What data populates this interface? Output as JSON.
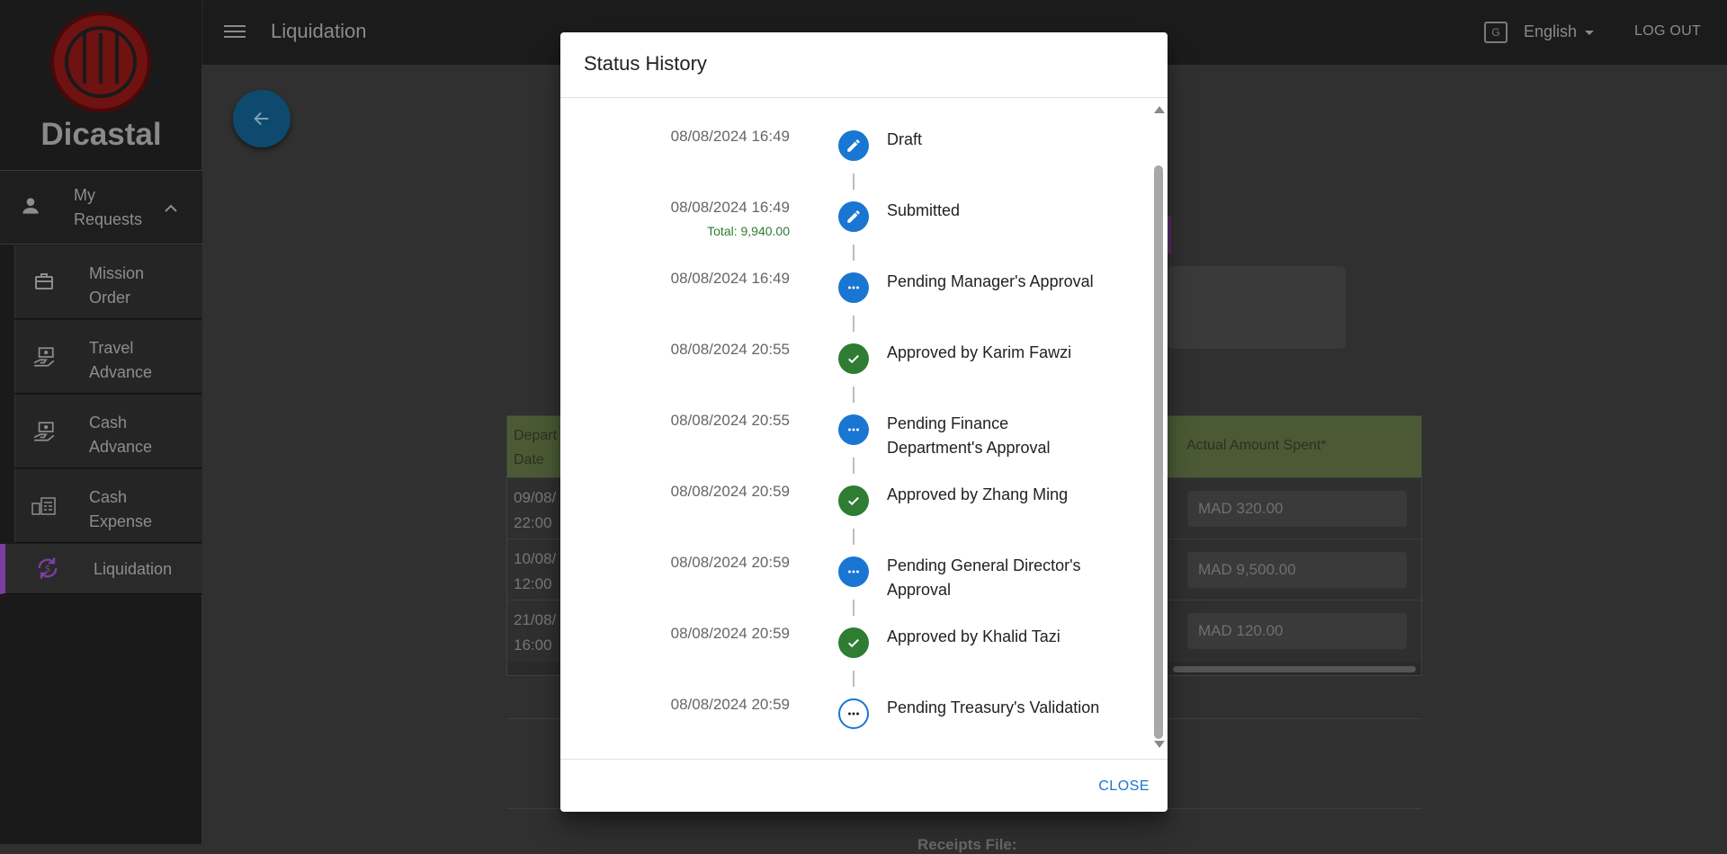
{
  "brand": {
    "name": "Dicastal"
  },
  "sidebar": {
    "group": {
      "label": "My Requests",
      "icon": "person-icon"
    },
    "items": [
      {
        "label": "Mission Order",
        "icon": "briefcase-icon"
      },
      {
        "label": "Travel Advance",
        "icon": "money-hand-icon"
      },
      {
        "label": "Cash Advance",
        "icon": "money-hand-icon"
      },
      {
        "label": "Cash Expense",
        "icon": "cash-register-icon"
      },
      {
        "label": "Liquidation",
        "icon": "sync-icon",
        "active": true
      }
    ]
  },
  "topbar": {
    "title": "Liquidation",
    "language": "English",
    "logout": "LOG OUT"
  },
  "background": {
    "table": {
      "header_left": "Departure Date",
      "header_right": "Actual Amount Spent*",
      "rows": [
        {
          "date": "09/08/",
          "time": "22:00",
          "amount": "MAD 320.00"
        },
        {
          "date": "10/08/",
          "time": "12:00",
          "amount": "MAD 9,500.00"
        },
        {
          "date": "21/08/",
          "time": "16:00",
          "amount": "MAD 120.00"
        }
      ]
    },
    "receipts_label": "Receipts File:"
  },
  "dialog": {
    "title": "Status History",
    "close_label": "CLOSE",
    "entries": [
      {
        "date": "08/08/2024 16:49",
        "status": "Draft",
        "icon": "pencil-icon",
        "color": "#1976d2"
      },
      {
        "date": "08/08/2024 16:49",
        "status": "Submitted",
        "icon": "pencil-icon",
        "color": "#1976d2",
        "total": "Total: 9,940.00"
      },
      {
        "date": "08/08/2024 16:49",
        "status": "Pending Manager's Approval",
        "icon": "more-icon",
        "color": "#1976d2"
      },
      {
        "date": "08/08/2024 20:55",
        "status": "Approved by Karim Fawzi",
        "icon": "check-icon",
        "color": "#2e7d32"
      },
      {
        "date": "08/08/2024 20:55",
        "status": "Pending Finance Department's Approval",
        "icon": "more-icon",
        "color": "#1976d2"
      },
      {
        "date": "08/08/2024 20:59",
        "status": "Approved by Zhang Ming",
        "icon": "check-icon",
        "color": "#2e7d32"
      },
      {
        "date": "08/08/2024 20:59",
        "status": "Pending General Director's Approval",
        "icon": "more-icon",
        "color": "#1976d2"
      },
      {
        "date": "08/08/2024 20:59",
        "status": "Approved by Khalid Tazi",
        "icon": "check-icon",
        "color": "#2e7d32"
      },
      {
        "date": "08/08/2024 20:59",
        "status": "Pending Treasury's Validation",
        "icon": "more-outline-icon",
        "color": "#1976d2"
      }
    ]
  }
}
